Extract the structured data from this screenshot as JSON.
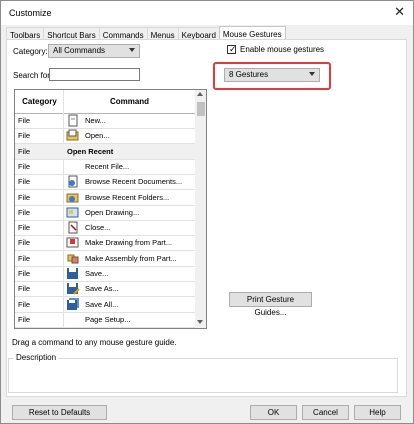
{
  "window": {
    "title": "Customize"
  },
  "tabs": [
    {
      "label": "Toolbars",
      "active": false
    },
    {
      "label": "Shortcut Bars",
      "active": false
    },
    {
      "label": "Commands",
      "active": false
    },
    {
      "label": "Menus",
      "active": false
    },
    {
      "label": "Keyboard",
      "active": false
    },
    {
      "label": "Mouse Gestures",
      "active": true
    }
  ],
  "filters": {
    "category_label": "Category:",
    "category_value": "All Commands",
    "search_label": "Search for:",
    "search_value": ""
  },
  "table": {
    "headers": {
      "category": "Category",
      "command": "Command"
    },
    "rows": [
      {
        "category": "File",
        "command": "New...",
        "icon": "new-document-icon",
        "group": false
      },
      {
        "category": "File",
        "command": "Open...",
        "icon": "open-folder-icon",
        "group": false
      },
      {
        "category": "File",
        "command": "Open Recent",
        "icon": "",
        "group": true
      },
      {
        "category": "File",
        "command": "Recent File...",
        "icon": "",
        "group": false
      },
      {
        "category": "File",
        "command": "Browse Recent Documents...",
        "icon": "browse-recent-documents-icon",
        "group": false
      },
      {
        "category": "File",
        "command": "Browse Recent Folders...",
        "icon": "browse-recent-folders-icon",
        "group": false
      },
      {
        "category": "File",
        "command": "Open Drawing...",
        "icon": "open-drawing-icon",
        "group": false
      },
      {
        "category": "File",
        "command": "Close...",
        "icon": "close-document-icon",
        "group": false
      },
      {
        "category": "File",
        "command": "Make Drawing from Part...",
        "icon": "make-drawing-icon",
        "group": false
      },
      {
        "category": "File",
        "command": "Make Assembly from Part...",
        "icon": "make-assembly-icon",
        "group": false
      },
      {
        "category": "File",
        "command": "Save...",
        "icon": "save-icon",
        "group": false
      },
      {
        "category": "File",
        "command": "Save As...",
        "icon": "save-as-icon",
        "group": false
      },
      {
        "category": "File",
        "command": "Save All...",
        "icon": "save-all-icon",
        "group": false
      },
      {
        "category": "File",
        "command": "Page Setup...",
        "icon": "",
        "group": false
      }
    ]
  },
  "gestures": {
    "enable_label": "Enable mouse gestures",
    "enabled": true,
    "count_value": "8 Gestures",
    "print_button": "Print Gesture Guides..."
  },
  "hint": "Drag a command to any mouse gesture guide.",
  "description_label": "Description",
  "buttons": {
    "reset": "Reset to Defaults",
    "ok": "OK",
    "cancel": "Cancel",
    "help": "Help"
  },
  "colors": {
    "highlight": "#e0393e"
  }
}
